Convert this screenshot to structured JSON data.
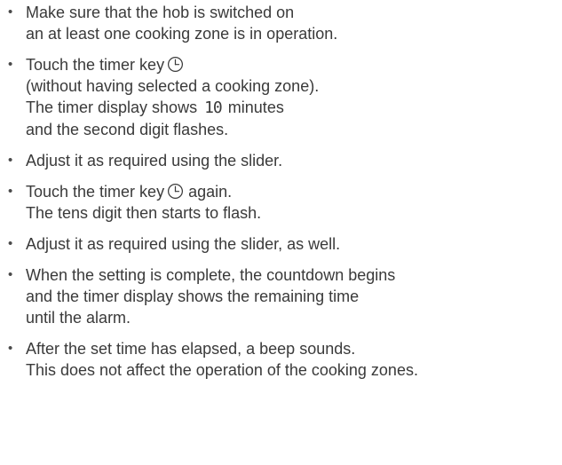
{
  "steps": [
    {
      "lines": [
        "Make sure that the hob is switched on",
        "an at least one cooking zone is in operation."
      ]
    },
    {
      "line1_prefix": "Touch the timer key",
      "icon": "clock-icon",
      "lines_after": [
        "(without having selected a cooking zone)."
      ],
      "display_prefix": "The timer display shows",
      "display_value": "10",
      "display_suffix": "minutes",
      "last_line": "and the second digit flashes."
    },
    {
      "lines": [
        "Adjust it as required using the slider."
      ]
    },
    {
      "line1_prefix": "Touch the timer key",
      "icon": "clock-icon",
      "line1_suffix": "again.",
      "lines_after": [
        "The tens digit then starts to flash."
      ]
    },
    {
      "lines": [
        "Adjust it as required using the slider, as well."
      ]
    },
    {
      "lines": [
        "When the setting is complete, the countdown begins",
        "and the timer display shows the remaining time",
        "until the alarm."
      ]
    },
    {
      "lines": [
        "After the set time has elapsed, a beep sounds.",
        "This does not affect the operation of the cooking zones."
      ]
    }
  ],
  "bullet_char": "•"
}
